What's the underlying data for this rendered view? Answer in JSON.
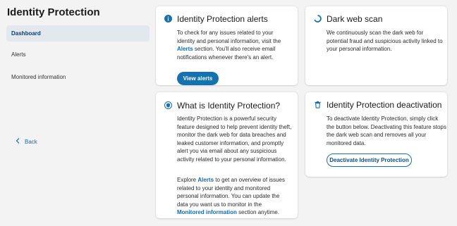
{
  "sidebar": {
    "title": "Identity Protection",
    "items": [
      {
        "label": "Dashboard"
      },
      {
        "label": "Alerts"
      },
      {
        "label": "Monitored information"
      }
    ],
    "back_label": "Back"
  },
  "cards": {
    "alerts": {
      "icon": "info-icon",
      "title": "Identity Protection alerts",
      "text_1": "To check for any issues related to your identity and personal information, visit the",
      "link": "Alerts",
      "text_2": "section. You'll also receive email notifications whenever there's an alert.",
      "button": "View alerts"
    },
    "dark_web": {
      "icon": "spinner-icon",
      "title": "Dark web scan",
      "text": "We continuously scan the dark web for potential fraud and suspicious activity linked to your personal information."
    },
    "what_is": {
      "icon": "shield-icon",
      "title": "What is Identity Protection?",
      "para1": "Identity Protection is a powerful security feature designed to help prevent identity theft, monitor the dark web for data breaches and leaked customer information, and promptly alert you via email about any suspicious activity related to your personal information.",
      "para2_1": "Explore",
      "link_1": "Alerts",
      "para2_2": "to get an overview of issues related to your identity and monitored personal information. You can update the data you want us to monitor in the",
      "link_2": "Monitored information",
      "para2_3": "section anytime."
    },
    "deactivation": {
      "icon": "trash-icon",
      "title": "Identity Protection deactivation",
      "text": "To deactivate Identity Protection, simply click the button below. Deactivating this feature stops the dark web scan and removes all your monitored data.",
      "button": "Deactivate Identity Protection"
    }
  },
  "colors": {
    "accent": "#1472b0",
    "link": "#0f6cbd",
    "active_nav": "#e3e8ee"
  }
}
